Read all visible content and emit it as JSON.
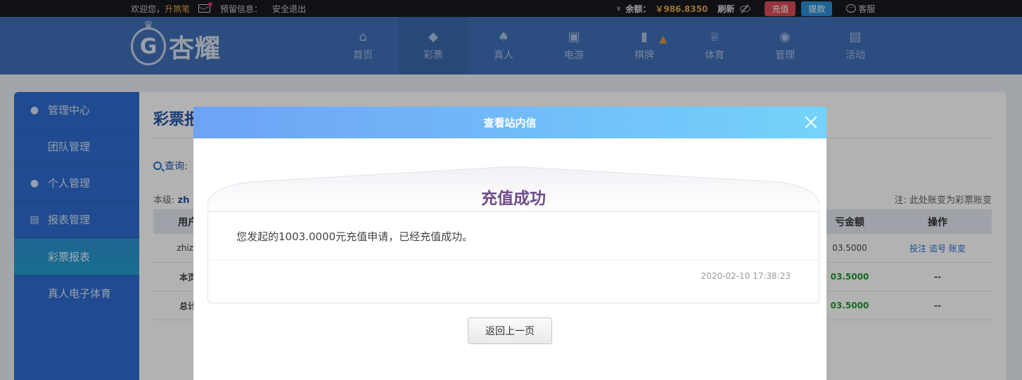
{
  "topbar": {
    "welcome": "欢迎您，",
    "username": "升煞笔",
    "notice_label": "预留信息：",
    "logout": "安全退出",
    "balance_label": "余额：",
    "balance_value": "￥986.8350",
    "refresh": "刷新",
    "recharge": "充值",
    "withdraw": "提款",
    "customer_service": "客服"
  },
  "header": {
    "logo_emblem": "G",
    "logo_text": "杏耀",
    "nav": [
      {
        "label": "首页",
        "icon": "home-icon",
        "glyph": "⌂"
      },
      {
        "label": "彩票",
        "icon": "ticket-icon",
        "glyph": "◆"
      },
      {
        "label": "真人",
        "icon": "dealer-icon",
        "glyph": "♠"
      },
      {
        "label": "电游",
        "icon": "slot-icon",
        "glyph": "▣"
      },
      {
        "label": "棋牌",
        "icon": "card-icon",
        "glyph": "▮"
      },
      {
        "label": "体育",
        "icon": "trophy-icon",
        "glyph": "♕"
      },
      {
        "label": "管理",
        "icon": "users-icon",
        "glyph": "◉"
      },
      {
        "label": "活动",
        "icon": "gift-icon",
        "glyph": "▤"
      }
    ]
  },
  "sidebar": {
    "items": [
      {
        "label": "管理中心",
        "type": "group",
        "icon": "users-icon",
        "glyph": "●"
      },
      {
        "label": "团队管理",
        "type": "sub"
      },
      {
        "label": "个人管理",
        "type": "group",
        "icon": "user-icon",
        "glyph": "●"
      },
      {
        "label": "报表管理",
        "type": "group",
        "icon": "report-icon",
        "glyph": "▤"
      },
      {
        "label": "彩票报表",
        "type": "sub",
        "active": true
      },
      {
        "label": "真人电子体育",
        "type": "sub"
      }
    ]
  },
  "content": {
    "title": "彩票报",
    "query_label": "查询:",
    "level_label": "本级:",
    "level_value": "zh",
    "note": "注: 此处账变为彩票账变",
    "table": {
      "headers": {
        "user": "用户",
        "amount": "亏金额",
        "op": "操作"
      },
      "rows": [
        {
          "user": "zhizh",
          "amount": "03.5000",
          "op": "投注 追号 账变"
        },
        {
          "user": "本页",
          "amount": "03.5000",
          "op": "--"
        },
        {
          "user": "总计",
          "amount": "03.5000",
          "op": "--"
        }
      ]
    }
  },
  "modal": {
    "title": "查看站内信",
    "letter_title": "充值成功",
    "message": "您发起的1003.0000元充值申请，已经充值成功。",
    "time": "2020-02-10 17:38:23",
    "back_button": "返回上一页"
  }
}
